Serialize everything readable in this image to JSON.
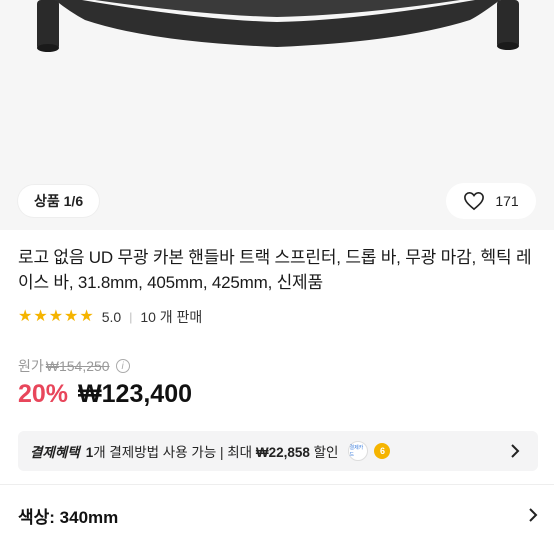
{
  "gallery": {
    "counter": "상품 1/6",
    "likes": "171",
    "image_alt": "carbon handlebar product photo"
  },
  "product": {
    "title": "로고 없음 UD 무광 카본 핸들바 트랙 스프린터, 드롭 바, 무광 마감, 헥틱 레이스 바, 31.8mm, 405mm, 425mm, 신제품",
    "rating": "5.0",
    "stars": 5,
    "sales": "10 개 판매"
  },
  "price": {
    "origin_label": "원가",
    "origin_price": "₩154,250",
    "info_icon": "i",
    "discount": "20%",
    "sale_price": "₩123,400"
  },
  "benefit": {
    "title": "결제혜택",
    "text_count": "1",
    "text_mid": "개 결제방법 사용 가능 | 최대 ",
    "max_amount": "₩22,858",
    "text_end": " 할인",
    "icon_a": "kakaopay-icon",
    "icon_a_text": "결제카드",
    "icon_b": "coin-icon",
    "icon_b_text": "6"
  },
  "option": {
    "label": "색상: 340mm"
  },
  "colors": {
    "accent_red": "#e8465b",
    "star": "#f5b400",
    "benefit_bg": "#f4f4f5"
  }
}
